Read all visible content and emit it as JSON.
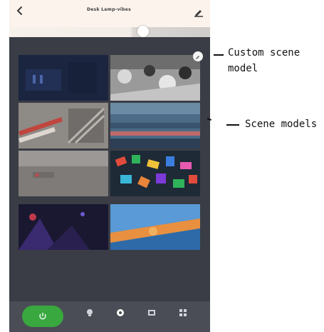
{
  "header": {
    "title": "Desk Lamp-vibes"
  },
  "slider": {
    "value_fraction": 0.66
  },
  "annotations": {
    "custom_scene_line1": "Custom scene",
    "custom_scene_line2": "model",
    "scene_models": "Scene models"
  },
  "tiles": [
    {
      "name": "scene-tile-dark-blue",
      "theme": "dark-blue"
    },
    {
      "name": "scene-tile-black-white",
      "theme": "black-white"
    },
    {
      "name": "scene-tile-pencils",
      "theme": "pencils"
    },
    {
      "name": "scene-tile-blue-stripes",
      "theme": "blue-stripes"
    },
    {
      "name": "scene-tile-grey",
      "theme": "grey"
    },
    {
      "name": "scene-tile-colorful",
      "theme": "colorful"
    },
    {
      "name": "scene-tile-purple-dark",
      "theme": "purple-dark"
    },
    {
      "name": "scene-tile-blue-orange",
      "theme": "blue-orange"
    }
  ],
  "colors": {
    "header_bg": "#fbf3ec",
    "app_bg": "#2f323a",
    "grid_bg": "#3a3d45",
    "nav_bg": "#4a4d55",
    "nav_active": "#39a83f"
  },
  "bottom_nav": {
    "items": [
      {
        "icon": "power-icon",
        "active": true
      },
      {
        "icon": "bulb-icon",
        "active": false
      },
      {
        "icon": "palette-icon",
        "active": false
      },
      {
        "icon": "film-icon",
        "active": false
      },
      {
        "icon": "grid-icon",
        "active": false
      }
    ]
  }
}
